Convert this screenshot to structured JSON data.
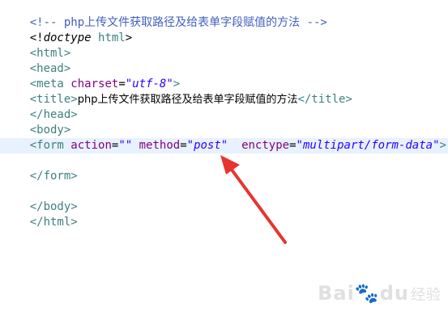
{
  "editor": {
    "lines": {
      "l1": {
        "comment": "<!-- php上传文件获取路径及给表单字段赋值的方法 -->"
      },
      "l2": {
        "open": "<!",
        "doctype": "doctype",
        "name": " html",
        "close": ">"
      },
      "l3": {
        "tag": "<html>"
      },
      "l4": {
        "tag": "<head>"
      },
      "l5": {
        "tag_open": "<meta",
        "attr": " charset",
        "eq": "=",
        "value": "\"utf-8\"",
        "tag_close": ">"
      },
      "l6": {
        "tag_open": "<title>",
        "text": "php上传文件获取路径及给表单字段赋值的方法",
        "tag_close": "</title>"
      },
      "l7": {
        "tag": "</head>"
      },
      "l8": {
        "tag": "<body>"
      },
      "l9": {
        "tag_open": "<form",
        "attr1": " action",
        "eq1": "=",
        "value1": "\"\"",
        "attr2": " method",
        "eq2": "=",
        "value2": "\"post\"",
        "attr3": "  enctype",
        "eq3": "=",
        "value3": "\"multipart/form-data\"",
        "tag_close": ">"
      },
      "l10": {
        "tag": ""
      },
      "l11": {
        "tag": "</form>"
      },
      "l12": {
        "tag": ""
      },
      "l13": {
        "tag": "</body>"
      },
      "l14": {
        "tag": "</html>"
      }
    },
    "arrow_color": "#e8342f",
    "highlight_color": "#e8f2fe"
  },
  "watermark": {
    "main": "Bai",
    "paw": "du",
    "sub": "经验"
  }
}
